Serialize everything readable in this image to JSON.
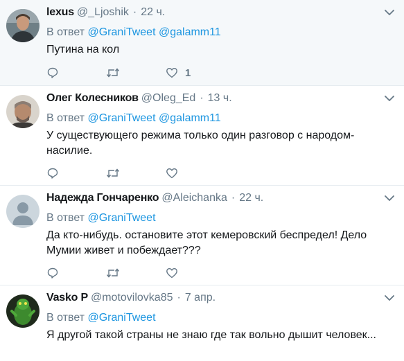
{
  "tweets": [
    {
      "fullname": "lexus",
      "handle": "@_Ljoshik",
      "separator": "·",
      "time": "22 ч.",
      "reply_label": "В ответ",
      "mentions": [
        "@GraniTweet",
        "@galamm11"
      ],
      "text": "Путина на кол",
      "like_count": "1"
    },
    {
      "fullname": "Олег Колесников",
      "handle": "@Oleg_Ed",
      "separator": "·",
      "time": "13 ч.",
      "reply_label": "В ответ",
      "mentions": [
        "@GraniTweet",
        "@galamm11"
      ],
      "text": "У существующего режима только один разговор с народом-насилие.",
      "like_count": ""
    },
    {
      "fullname": "Надежда Гончаренко",
      "handle": "@Aleichanka",
      "separator": "·",
      "time": "22 ч.",
      "reply_label": "В ответ",
      "mentions": [
        "@GraniTweet"
      ],
      "text": "Да кто-нибудь. остановите этот кемеровский беспредел! Дело Мумии живет и побеждает???",
      "like_count": ""
    },
    {
      "fullname": "Vasko P",
      "handle": "@motovilovka85",
      "separator": "·",
      "time": "7 апр.",
      "reply_label": "В ответ",
      "mentions": [
        "@GraniTweet"
      ],
      "text": "Я другой такой страны не знаю где так вольно дышит человек...",
      "like_count": ""
    }
  ],
  "icons": {
    "reply": "reply-icon",
    "retweet": "retweet-icon",
    "like": "heart-icon",
    "caret": "chevron-down-icon"
  },
  "colors": {
    "mention": "#1b95e0",
    "secondary_text": "#657786",
    "primary_text": "#14171a",
    "highlight_bg": "#f5f8fa",
    "divider": "#e6ecf0"
  }
}
